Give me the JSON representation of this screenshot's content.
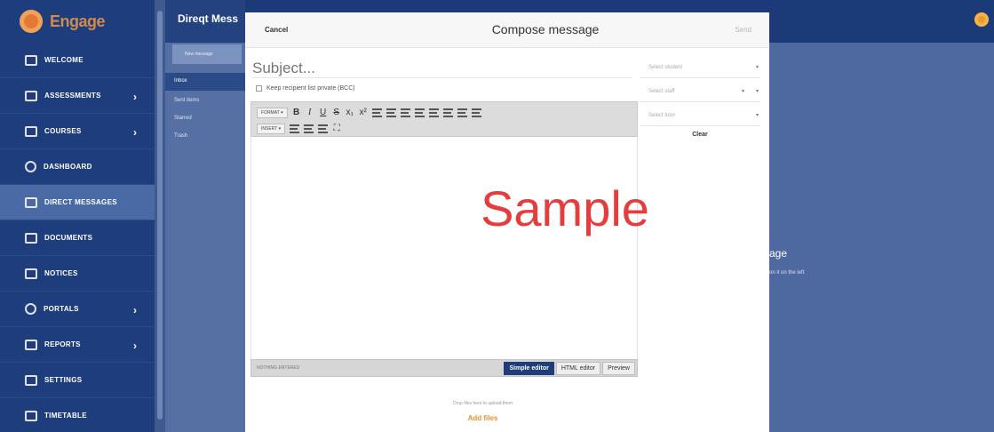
{
  "app": {
    "brand": "Engage"
  },
  "sidebar": {
    "items": [
      {
        "label": "Welcome",
        "icon": "home-icon",
        "chevron": false
      },
      {
        "label": "Assessments",
        "icon": "assessments-icon",
        "chevron": true
      },
      {
        "label": "Courses",
        "icon": "courses-icon",
        "chevron": true
      },
      {
        "label": "Dashboard",
        "icon": "dashboard-icon",
        "chevron": false
      },
      {
        "label": "Direct Messages",
        "icon": "messages-icon",
        "chevron": false,
        "active": true
      },
      {
        "label": "Documents",
        "icon": "documents-icon",
        "chevron": false
      },
      {
        "label": "Notices",
        "icon": "notices-icon",
        "chevron": false
      },
      {
        "label": "Portals",
        "icon": "portals-icon",
        "chevron": true
      },
      {
        "label": "Reports",
        "icon": "reports-icon",
        "chevron": true
      },
      {
        "label": "Settings",
        "icon": "wrench-icon",
        "chevron": false
      },
      {
        "label": "Timetable",
        "icon": "timetable-icon",
        "chevron": false
      }
    ],
    "chevron_glyph": "›"
  },
  "messages": {
    "title": "Direqt Mess",
    "new_message": "New message",
    "folders": [
      "Inbox",
      "Sent items",
      "Starred",
      "Trash"
    ]
  },
  "background_hint": {
    "title": "age",
    "subtitle": "on it on the left"
  },
  "modal": {
    "cancel": "Cancel",
    "title": "Compose message",
    "send": "Send",
    "subject_placeholder": "Subject...",
    "bcc_label": "Keep recipient list private (BCC)",
    "toolbar": {
      "format_label": "FORMAT",
      "insert_label": "INSERT",
      "bold": "B",
      "italic": "I",
      "underline": "U",
      "strike": "S",
      "subscript": "x₁",
      "superscript": "x²"
    },
    "status_path": "NOTHING ENTERED",
    "modes": [
      "Simple editor",
      "HTML editor",
      "Preview"
    ],
    "active_mode": "Simple editor",
    "dropzone": "Drop files here to upload them",
    "add_files": "Add files",
    "filters": [
      {
        "placeholder": "Select student"
      },
      {
        "placeholder": "Select staff"
      },
      {
        "placeholder": "Select tutor"
      }
    ],
    "clear": "Clear"
  },
  "watermark": "Sample",
  "colors": {
    "sidebar": "#1e3d7c",
    "accent": "#e8912e",
    "active_tab": "#1f3d78",
    "watermark": "#e53d3d"
  }
}
